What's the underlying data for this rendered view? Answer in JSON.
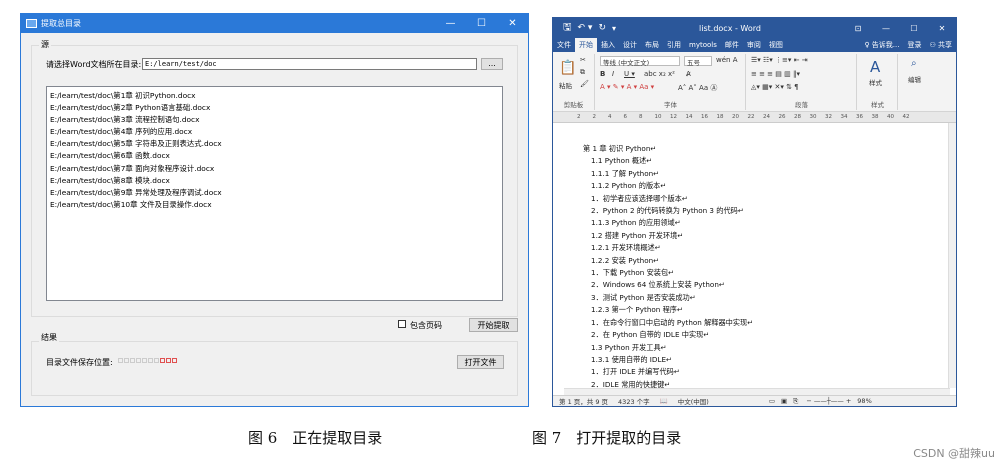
{
  "left": {
    "title": "提取总目录",
    "source_group": "源",
    "dir_label": "请选择Word文档所在目录:",
    "dir_value": "E:/learn/test/doc",
    "browse_label": "...",
    "files": [
      "E:/learn/test/doc\\第1章  初识Python.docx",
      "E:/learn/test/doc\\第2章  Python语言基础.docx",
      "E:/learn/test/doc\\第3章  流程控制语句.docx",
      "E:/learn/test/doc\\第4章  序列的应用.docx",
      "E:/learn/test/doc\\第5章  字符串及正则表达式.docx",
      "E:/learn/test/doc\\第6章  函数.docx",
      "E:/learn/test/doc\\第7章  面向对象程序设计.docx",
      "E:/learn/test/doc\\第8章  模块.docx",
      "E:/learn/test/doc\\第9章  异常处理及程序调试.docx",
      "E:/learn/test/doc\\第10章  文件及目录操作.docx"
    ],
    "include_page_label": "包含页码",
    "start_label": "开始提取",
    "result_group": "结果",
    "save_label": "目录文件保存位置:",
    "open_label": "打开文件"
  },
  "word": {
    "qat_save": "🖫",
    "title": "list.docx - Word",
    "tabs": [
      "文件",
      "开始",
      "插入",
      "设计",
      "布局",
      "引用",
      "mytools",
      "邮件",
      "审阅",
      "视图",
      "♀ 告诉我...",
      "登录",
      "⚇ 共享"
    ],
    "active_tab": "开始",
    "font_name": "等线 (中文正文)",
    "font_size": "五号",
    "groups": [
      "剪贴板",
      "字体",
      "段落",
      "样式",
      "编辑"
    ],
    "paste_label": "粘贴",
    "style_label": "样式",
    "edit_label": "编辑",
    "ruler_ticks": [
      "2",
      "2",
      "4",
      "6",
      "8",
      "10",
      "12",
      "14",
      "16",
      "18",
      "20",
      "22",
      "24",
      "26",
      "28",
      "30",
      "32",
      "34",
      "36",
      "38",
      "40",
      "42"
    ],
    "lines": [
      "第 1 章  初识 Python↵",
      "1.1  Python 概述↵",
      "1.1.1  了解 Python↵",
      "1.1.2  Python 的版本↵",
      "1．初学者应该选择哪个版本↵",
      "2．Python 2 的代码转换为 Python 3 的代码↵",
      "1.1.3  Python 的应用领域↵",
      "1.2  搭建 Python 开发环境↵",
      "1.2.1  开发环境概述↵",
      "1.2.2  安装 Python↵",
      "1．下载 Python 安装包↵",
      "2．Windows 64 位系统上安装 Python↵",
      "3．测试 Python 是否安装成功↵",
      "1.2.3  第一个 Python 程序↵",
      "1．在命令行窗口中启动的 Python 解释器中实现↵",
      "2．在 Python 自带的 IDLE 中实现↵",
      "1.3  Python 开发工具↵",
      "1.3.1  使用自带的 IDLE↵",
      "1．打开 IDLE 并编写代码↵",
      "2．IDLE 常用的快捷键↵"
    ],
    "status": {
      "page": "第 1 页，共 9 页",
      "words": "4323 个字",
      "lang": "中文(中国)",
      "zoom": "98%"
    }
  },
  "captions": {
    "fig6": "图 6　正在提取目录",
    "fig7": "图 7　打开提取的目录"
  },
  "watermark": "CSDN @甜辣uu"
}
